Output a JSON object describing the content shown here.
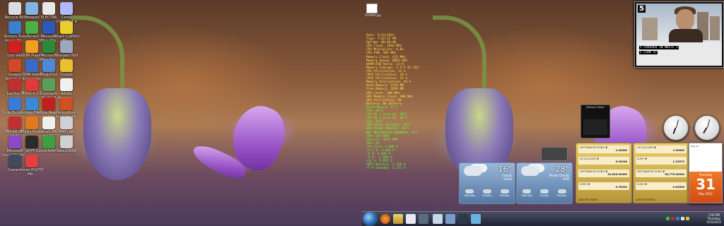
{
  "left_desktop": {
    "icons": [
      {
        "label": "Recycle Bin",
        "color": "#d8dde4"
      },
      {
        "label": "Notepad",
        "color": "#7fb4e6"
      },
      {
        "label": "ELECTRA",
        "color": "#e8e8e8"
      },
      {
        "label": "Cenel CONNECT 4",
        "color": "#b0b8ff"
      },
      {
        "label": "Acronis True Image Ho...",
        "color": "#3a7fd0"
      },
      {
        "label": "uTorrent",
        "color": "#4ab04a"
      },
      {
        "label": "Microsoft Office Wor...",
        "color": "#2a5ab8"
      },
      {
        "label": "Smart CutPrint Fil...",
        "color": "#e8d030"
      },
      {
        "label": "Lich Việt",
        "color": "#d02020"
      },
      {
        "label": "GOM Player",
        "color": "#f0a020"
      },
      {
        "label": "Microsoft Office Exc...",
        "color": "#2a8a3a"
      },
      {
        "label": "Sharpen Tool for...",
        "color": "#9aa8c0"
      },
      {
        "label": "Google Sketchup 8",
        "color": "#d04a2a"
      },
      {
        "label": "GOM Video Converter",
        "color": "#3a6ac8"
      },
      {
        "label": "MagicDisc",
        "color": "#4a8ad8"
      },
      {
        "label": "Google Chrome",
        "color": "#e8c030"
      },
      {
        "label": "LayOut 3",
        "color": "#c03030"
      },
      {
        "label": "BSSA 4.2.0",
        "color": "#e03a3a"
      },
      {
        "label": "Camtasia Studio 7",
        "color": "#5aa05a"
      },
      {
        "label": "Adobe Acrobat...",
        "color": "#f0f0f0"
      },
      {
        "label": "Style Builder 2",
        "color": "#3a7ad8"
      },
      {
        "label": "Google Earth",
        "color": "#3a8ad8"
      },
      {
        "label": "Adobe Reader X",
        "color": "#c02020"
      },
      {
        "label": "mikroProg Suite for PIC",
        "color": "#d05020"
      },
      {
        "label": "MPLAB IDE v8.84",
        "color": "#c03030"
      },
      {
        "label": "Mozilla Firefox",
        "color": "#e07a20"
      },
      {
        "label": "mikroC PRO for PIC",
        "color": "#f0f0f0"
      },
      {
        "label": "MATLAB Designer",
        "color": "#d0d0d8"
      },
      {
        "label": "Microsoft Visual Studio...",
        "color": "#8a4ac8"
      },
      {
        "label": "WYFF.7",
        "color": "#2a2a2a"
      },
      {
        "label": "CorelDRAW X4",
        "color": "#3aa040"
      },
      {
        "label": "CorelDRAW",
        "color": "#d0d0d0"
      },
      {
        "label": "Camera",
        "color": "#404a5a"
      },
      {
        "label": "Cenel PHOTO PAI...",
        "color": "#e04040"
      }
    ]
  },
  "right_desktop": {
    "file_icon_label": "220000.jpg",
    "sysinfo": [
      {
        "text": "Date: 5/31/2012",
        "c": "y"
      },
      {
        "text": "Time: 7:02:53 PM",
        "c": "y"
      },
      {
        "text": "UpTime: 00:04:00",
        "c": "y"
      },
      {
        "text": "CPU Clock: 1810 MHz",
        "c": "y"
      },
      {
        "text": "CPU Multiplier: 6.0x",
        "c": "y"
      },
      {
        "text": "CPU FSB: 302 MHz",
        "c": "y"
      },
      {
        "text": "Memory Clock: 453 MHz",
        "c": "y"
      },
      {
        "text": "Memory Speed: DDR2-905",
        "c": "y"
      },
      {
        "text": "DRAM:FSB Ratio: 12:8",
        "c": "y"
      },
      {
        "text": "Memory Timings: 5-5-5-15 CR2",
        "c": "y"
      },
      {
        "text": "CPU Utilization: 21 %",
        "c": "y"
      },
      {
        "text": "CPU1 Utilization: 19 %",
        "c": "y"
      },
      {
        "text": "CPU2 Utilization: 22 %",
        "c": "y"
      },
      {
        "text": "Memory Utilization: 43 %",
        "c": "y"
      },
      {
        "text": "Used Memory: 1524 MB",
        "c": "y"
      },
      {
        "text": "Free Memory: 2039 MB",
        "c": "y"
      },
      {
        "text": "GPU Clock: 300 MHz",
        "c": "y"
      },
      {
        "text": "GPU Memory Clock: 300 MHz",
        "c": "y"
      },
      {
        "text": "GPU Utilization: 0%",
        "c": "y"
      },
      {
        "text": "Battery: No Battery",
        "c": "y"
      },
      {
        "text": "Motherboard: 53°C",
        "c": "g"
      },
      {
        "text": "CPU: 49°C",
        "c": "g"
      },
      {
        "text": "CPU #1 / Core #1: 48°C",
        "c": "g"
      },
      {
        "text": "CPU #1 / Core #2: 48°C",
        "c": "g"
      },
      {
        "text": "Aux: 34°C",
        "c": "g"
      },
      {
        "text": "GPU Diode (DispIO): 43°C",
        "c": "g"
      },
      {
        "text": "GPU Diode (MemIO): 40°C",
        "c": "g"
      },
      {
        "text": "WDC WD2500AAKS-00WWBA0: 33°C",
        "c": "g"
      },
      {
        "text": "CPU: 524 RPM",
        "c": "g"
      },
      {
        "text": "Chassis: 1875 RPM",
        "c": "g"
      },
      {
        "text": "GPU: 0%",
        "c": "g"
      },
      {
        "text": "CPU Core: 1.088 V",
        "c": "g"
      },
      {
        "text": "+3.3 V: 3.344 V",
        "c": "g"
      },
      {
        "text": "+5 V: 5.029 V",
        "c": "g"
      },
      {
        "text": "-5 V: -1.088 V",
        "c": "g"
      },
      {
        "text": "+12 V: 9.856 V",
        "c": "g"
      },
      {
        "text": "VBAT Battery: 3.248 V",
        "c": "g"
      },
      {
        "text": "+5 V Standby: 5.251 V",
        "c": "g"
      }
    ],
    "video": {
      "channel_number": "5",
      "subtitle_line1": "I COVERED IN WHITE 2",
      "subtitle_line2": "I LOOK AT"
    },
    "network_meter": {
      "title": "Network Meter"
    },
    "weather": [
      {
        "temp": "16°",
        "condition": "Cloudy",
        "location": "Hanoi",
        "days": [
          "Saturday",
          "Sunday",
          "Monday"
        ]
      },
      {
        "temp": "28°",
        "condition": "Mostly Cloudy",
        "location": "HCM",
        "days": [
          "Saturday",
          "Sunday",
          "Monday"
        ]
      }
    ],
    "currency_left": {
      "rows": [
        {
          "name": "VIETNAMESE DONG ▼",
          "value": "1.00000"
        },
        {
          "name": "US DOLLARS ▼",
          "value": "0.00048"
        },
        {
          "name": "VIETNAMESE DONG ▼",
          "value": "20,835.00000"
        },
        {
          "name": "EURO ▼",
          "value": "0.78200"
        }
      ],
      "footer": "DATA PROVIDERS"
    },
    "currency_right": {
      "rows": [
        {
          "name": "US DOLLARS ▼",
          "value": "1.00000"
        },
        {
          "name": "EURO ▼",
          "value": "1.23573"
        },
        {
          "name": "VIETNAMESE DONG ▼",
          "value": "20,775.00000"
        },
        {
          "name": "EURO ▼",
          "value": "0.81696"
        }
      ],
      "footer": "DATA PROVIDERS"
    },
    "calendar": {
      "month_header": "May 12",
      "day_name": "Thursday",
      "day_number": "31",
      "month_name": "May 2012"
    },
    "tray": {
      "time": "7:02 PM",
      "day": "Thursday",
      "date": "5/31/2012"
    }
  }
}
